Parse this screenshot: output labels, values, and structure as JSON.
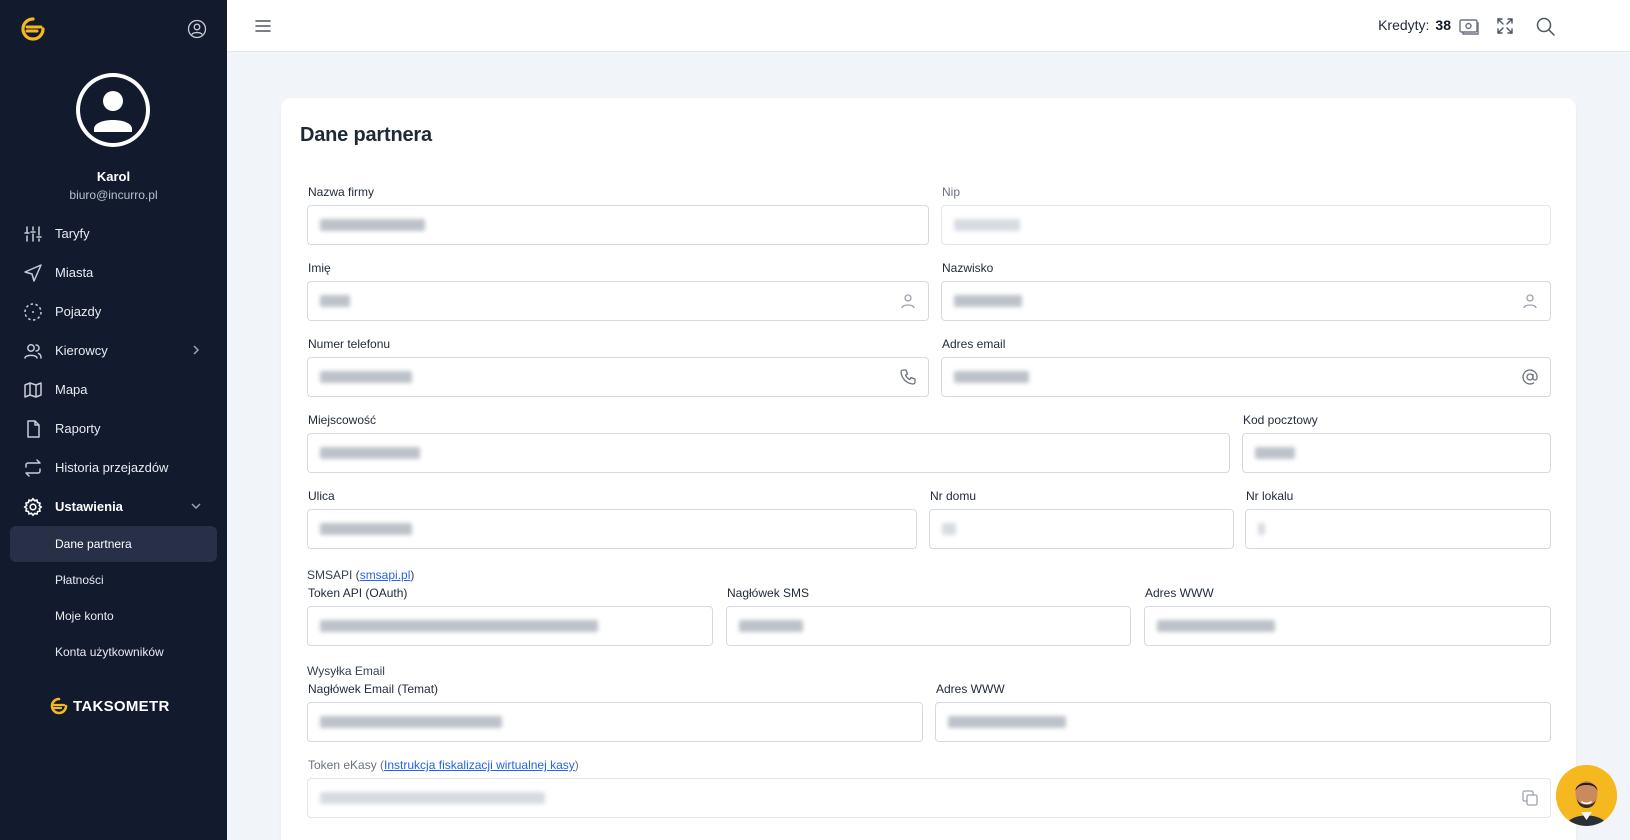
{
  "app": {
    "brand": "TAKSOMETR"
  },
  "user": {
    "name": "Karol",
    "email": "biuro@incurro.pl"
  },
  "nav": {
    "items": [
      {
        "label": "Taryfy",
        "icon": "sliders-icon"
      },
      {
        "label": "Miasta",
        "icon": "navigation-icon"
      },
      {
        "label": "Pojazdy",
        "icon": "focus-icon"
      },
      {
        "label": "Kierowcy",
        "icon": "users-icon"
      },
      {
        "label": "Mapa",
        "icon": "map-icon"
      },
      {
        "label": "Raporty",
        "icon": "file-icon"
      },
      {
        "label": "Historia przejazdów",
        "icon": "repeat-icon"
      },
      {
        "label": "Ustawienia",
        "icon": "gear-icon"
      }
    ],
    "subitems": [
      {
        "label": "Dane partnera"
      },
      {
        "label": "Płatności"
      },
      {
        "label": "Moje konto"
      },
      {
        "label": "Konta użytkowników"
      }
    ]
  },
  "topbar": {
    "credits_label": "Kredyty:",
    "credits_value": "38"
  },
  "page": {
    "title": "Dane partnera",
    "fields": {
      "nazwa_firmy": "Nazwa firmy",
      "nip": "Nip",
      "imie": "Imię",
      "nazwisko": "Nazwisko",
      "numer_telefonu": "Numer telefonu",
      "adres_email": "Adres email",
      "miejscowosc": "Miejscowość",
      "kod_pocztowy": "Kod pocztowy",
      "ulica": "Ulica",
      "nr_domu": "Nr domu",
      "nr_lokalu": "Nr lokalu",
      "token_api": "Token API (OAuth)",
      "naglowek_sms": "Nagłówek SMS",
      "adres_www_sms": "Adres WWW",
      "naglowek_email": "Nagłówek Email (Temat)",
      "adres_www_email": "Adres WWW",
      "token_ekasy": "Token eKasy"
    },
    "smsapi": {
      "prefix": "SMSAPI (",
      "link": "smsapi.pl",
      "suffix": ")"
    },
    "wysylka_email": "Wysyłka Email",
    "ekasy": {
      "prefix": "Token eKasy (",
      "link": "Instrukcja fiskalizacji wirtualnej kasy",
      "suffix": ")"
    }
  },
  "colors": {
    "sidebar_bg": "#121a2e",
    "accent": "#f5b81f",
    "link": "#2563eb",
    "page_bg": "#f1f4f8"
  }
}
